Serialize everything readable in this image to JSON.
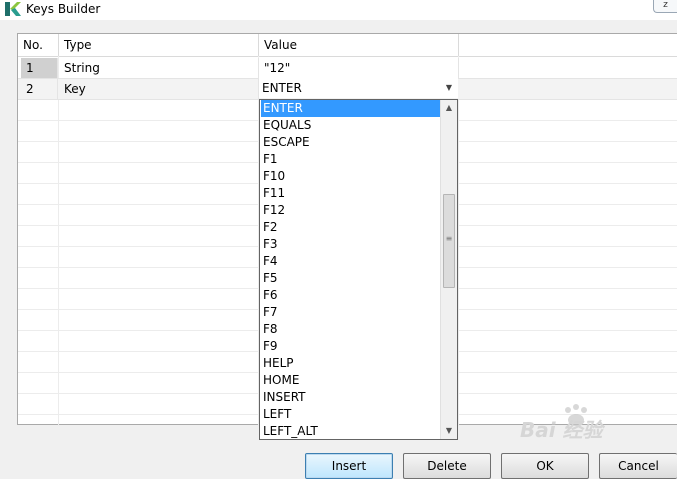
{
  "window": {
    "title": "Keys Builder",
    "corner_label": "z"
  },
  "table": {
    "columns": [
      "No.",
      "Type",
      "Value"
    ],
    "rows": [
      {
        "no": "1",
        "type": "String",
        "value": "\"12\""
      },
      {
        "no": "2",
        "type": "Key",
        "value": "ENTER"
      }
    ]
  },
  "dropdown": {
    "selected": "ENTER",
    "options": [
      "ENTER",
      "EQUALS",
      "ESCAPE",
      "F1",
      "F10",
      "F11",
      "F12",
      "F2",
      "F3",
      "F4",
      "F5",
      "F6",
      "F7",
      "F8",
      "F9",
      "HELP",
      "HOME",
      "INSERT",
      "LEFT",
      "LEFT_ALT"
    ]
  },
  "buttons": {
    "insert": "Insert",
    "delete": "Delete",
    "ok": "OK",
    "cancel": "Cancel"
  },
  "watermark": {
    "text": "Bai 经验"
  },
  "colors": {
    "selection": "#3399ff",
    "app_icon_dark": "#1f6f6a",
    "app_icon_light": "#8cc63f"
  }
}
